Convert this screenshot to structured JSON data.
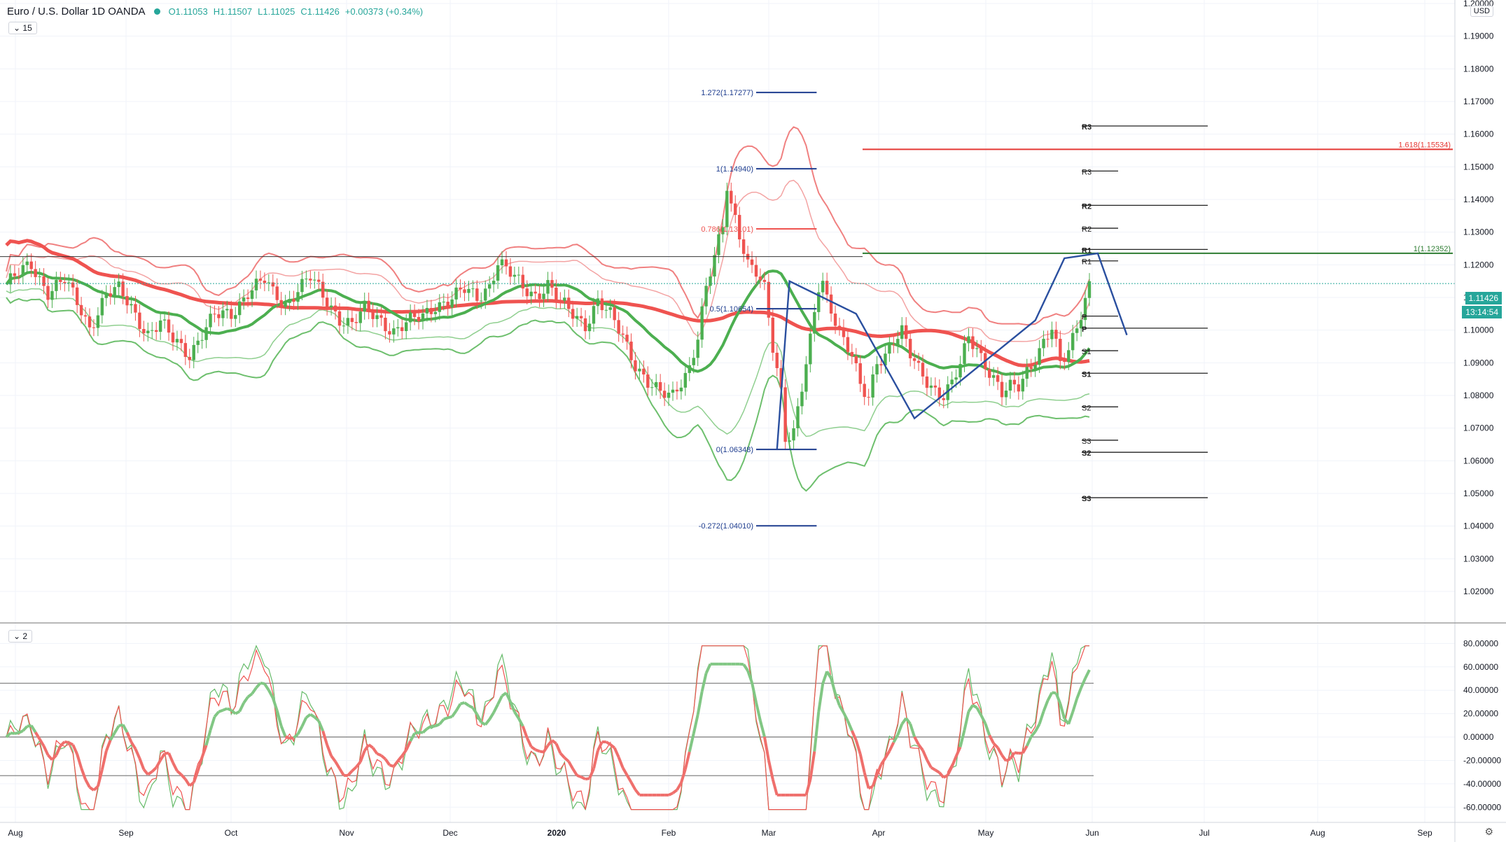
{
  "legend": {
    "symbol": "Euro / U.S. Dollar 1D OANDA",
    "open": "O1.11053",
    "high": "H1.11507",
    "low": "L1.11025",
    "close": "C1.11426",
    "change": "+0.00373 (+0.34%)"
  },
  "badges": {
    "main": "15",
    "osc": "2"
  },
  "currency": "USD",
  "last_price": "1.11426",
  "countdown": "13:14:54",
  "colors": {
    "up": "#26a69a",
    "bull": "#4caf50",
    "bear": "#ef5350",
    "ema": "#ef5350",
    "sma": "#4caf50",
    "fib": "#2962ff",
    "grid": "#f0f3fa"
  },
  "chart_data": {
    "type": "candlestick",
    "title": "Euro / U.S. Dollar 1D OANDA",
    "x_ticks": [
      "Aug",
      "Sep",
      "Oct",
      "Nov",
      "Dec",
      "2020",
      "Feb",
      "Mar",
      "Apr",
      "May",
      "Jun",
      "Jul",
      "Aug",
      "Sep"
    ],
    "price_axis": {
      "min": 1.02,
      "max": 1.2,
      "step": 0.01,
      "labels": [
        "1.20000",
        "1.19000",
        "1.18000",
        "1.17000",
        "1.16000",
        "1.15000",
        "1.14000",
        "1.13000",
        "1.12000",
        "1.11000",
        "1.10000",
        "1.09000",
        "1.08000",
        "1.07000",
        "1.06000",
        "1.05000",
        "1.04000",
        "1.03000",
        "1.02000"
      ]
    },
    "osc_axis": {
      "min": -70,
      "max": 85,
      "labels": [
        "80.00000",
        "60.00000",
        "40.00000",
        "20.00000",
        "0.00000",
        "-20.00000",
        "-40.00000",
        "-60.00000"
      ]
    },
    "osc_levels": [
      46,
      0,
      -33
    ],
    "fibonacci": [
      {
        "label": "1.272(1.17277)",
        "level": 1.17277
      },
      {
        "label": "1(1.14940)",
        "level": 1.1494
      },
      {
        "label": "0.786(1.13101)",
        "level": 1.13101
      },
      {
        "label": "0.5(1.10654)",
        "level": 1.10654
      },
      {
        "label": "0(1.06348)",
        "level": 1.06348
      },
      {
        "label": "-0.272(1.04010)",
        "level": 1.0401
      }
    ],
    "ext_lines": [
      {
        "label": "1.618(1.15534)",
        "level": 1.15534
      },
      {
        "label": "1(1.12352)",
        "level": 1.12352
      }
    ],
    "pivots_monthly": [
      {
        "label": "R3",
        "level": 1.1625
      },
      {
        "label": "R2",
        "level": 1.1382
      },
      {
        "label": "R1",
        "level": 1.1247
      },
      {
        "label": "P",
        "level": 1.1006
      },
      {
        "label": "S1",
        "level": 1.0868
      },
      {
        "label": "S2",
        "level": 1.0626
      },
      {
        "label": "S3",
        "level": 1.0487
      }
    ],
    "pivots_weekly": [
      {
        "label": "R3",
        "level": 1.1487
      },
      {
        "label": "R2",
        "level": 1.1312
      },
      {
        "label": "R1",
        "level": 1.1212
      },
      {
        "label": "P",
        "level": 1.1043
      },
      {
        "label": "S1",
        "level": 1.0937
      },
      {
        "label": "S2",
        "level": 1.0765
      },
      {
        "label": "S3",
        "level": 1.0663
      }
    ],
    "close_path": [
      [
        0,
        1.114
      ],
      [
        6,
        1.12
      ],
      [
        10,
        1.112
      ],
      [
        14,
        1.115
      ],
      [
        18,
        1.106
      ],
      [
        20,
        1.101
      ],
      [
        24,
        1.111
      ],
      [
        27,
        1.112
      ],
      [
        30,
        1.107
      ],
      [
        34,
        1.099
      ],
      [
        37,
        1.102
      ],
      [
        40,
        1.097
      ],
      [
        44,
        1.093
      ],
      [
        47,
        1.099
      ],
      [
        50,
        1.104
      ],
      [
        54,
        1.105
      ],
      [
        58,
        1.112
      ],
      [
        62,
        1.115
      ],
      [
        64,
        1.111
      ],
      [
        67,
        1.108
      ],
      [
        70,
        1.113
      ],
      [
        73,
        1.116
      ],
      [
        76,
        1.11
      ],
      [
        80,
        1.104
      ],
      [
        83,
        1.102
      ],
      [
        86,
        1.106
      ],
      [
        90,
        1.103
      ],
      [
        93,
        1.1
      ],
      [
        96,
        1.102
      ],
      [
        100,
        1.104
      ],
      [
        103,
        1.108
      ],
      [
        106,
        1.109
      ],
      [
        110,
        1.112
      ],
      [
        113,
        1.11
      ],
      [
        116,
        1.114
      ],
      [
        118,
        1.121
      ],
      [
        121,
        1.117
      ],
      [
        124,
        1.113
      ],
      [
        127,
        1.111
      ],
      [
        130,
        1.114
      ],
      [
        133,
        1.108
      ],
      [
        137,
        1.104
      ],
      [
        139,
        1.102
      ],
      [
        142,
        1.109
      ],
      [
        145,
        1.104
      ],
      [
        148,
        1.098
      ],
      [
        151,
        1.09
      ],
      [
        154,
        1.084
      ],
      [
        157,
        1.08
      ],
      [
        160,
        1.08
      ],
      [
        162,
        1.085
      ],
      [
        164,
        1.089
      ],
      [
        166,
        1.098
      ],
      [
        168,
        1.112
      ],
      [
        170,
        1.122
      ],
      [
        172,
        1.132
      ],
      [
        173,
        1.145
      ],
      [
        174,
        1.139
      ],
      [
        175,
        1.135
      ],
      [
        176,
        1.13
      ],
      [
        178,
        1.12
      ],
      [
        180,
        1.117
      ],
      [
        182,
        1.112
      ],
      [
        184,
        1.095
      ],
      [
        186,
        1.082
      ],
      [
        187,
        1.068
      ],
      [
        189,
        1.069
      ],
      [
        191,
        1.082
      ],
      [
        193,
        1.096
      ],
      [
        195,
        1.113
      ],
      [
        196,
        1.115
      ],
      [
        197,
        1.11
      ],
      [
        199,
        1.104
      ],
      [
        201,
        1.097
      ],
      [
        203,
        1.092
      ],
      [
        205,
        1.082
      ],
      [
        207,
        1.079
      ],
      [
        209,
        1.091
      ],
      [
        211,
        1.093
      ],
      [
        213,
        1.097
      ],
      [
        215,
        1.099
      ],
      [
        217,
        1.092
      ],
      [
        219,
        1.088
      ],
      [
        221,
        1.085
      ],
      [
        223,
        1.082
      ],
      [
        225,
        1.08
      ],
      [
        227,
        1.083
      ],
      [
        229,
        1.089
      ],
      [
        231,
        1.098
      ],
      [
        233,
        1.095
      ],
      [
        235,
        1.09
      ],
      [
        237,
        1.085
      ],
      [
        239,
        1.08
      ],
      [
        241,
        1.082
      ],
      [
        243,
        1.083
      ],
      [
        245,
        1.088
      ],
      [
        247,
        1.092
      ],
      [
        249,
        1.096
      ],
      [
        251,
        1.1
      ],
      [
        253,
        1.089
      ],
      [
        255,
        1.094
      ],
      [
        257,
        1.102
      ],
      [
        259,
        1.11
      ],
      [
        260,
        1.114
      ]
    ],
    "forecast_path": [
      [
        185,
        1.0635
      ],
      [
        188,
        1.115
      ],
      [
        204,
        1.105
      ],
      [
        218,
        1.073
      ],
      [
        247,
        1.103
      ],
      [
        254,
        1.122
      ],
      [
        262,
        1.1235
      ],
      [
        269,
        1.0985
      ]
    ],
    "fib_x_start": 180,
    "fib_x_end": 192
  }
}
